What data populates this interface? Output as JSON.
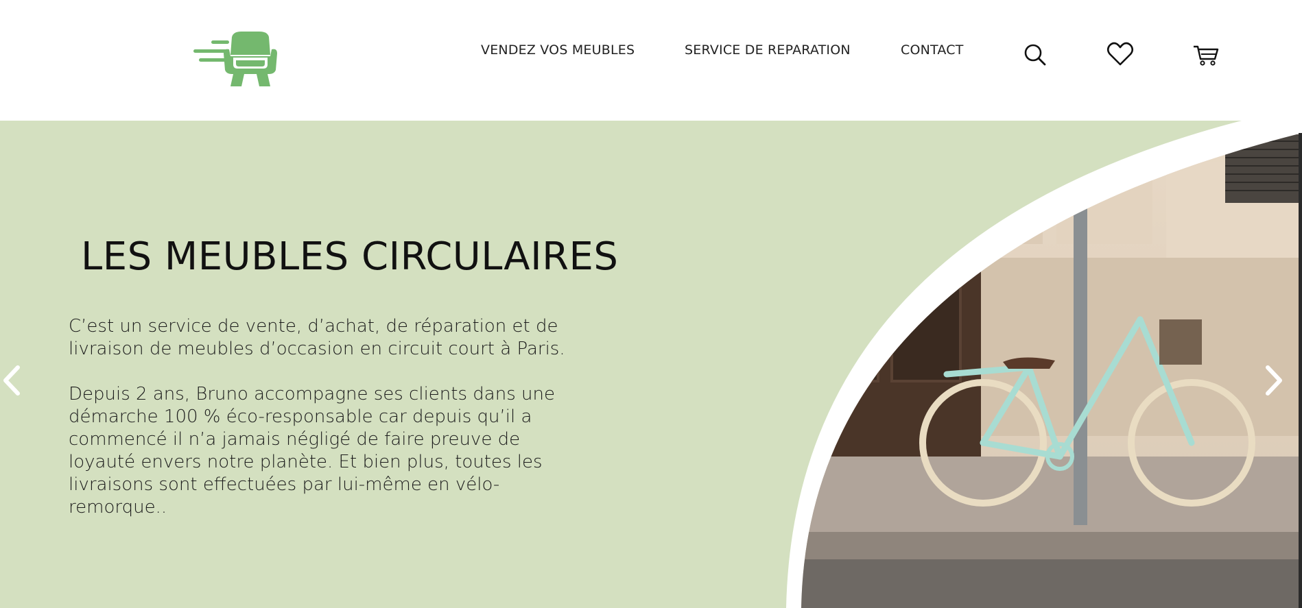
{
  "header": {
    "nav": {
      "sell": "VENDEZ VOS MEUBLES",
      "repair": "SERVICE DE REPARATION",
      "contact": "CONTACT"
    },
    "icons": {
      "logo": "armchair-logo-icon",
      "search": "search-icon",
      "wishlist": "heart-icon",
      "cart": "cart-icon"
    }
  },
  "hero": {
    "title": "LES MEUBLES CIRCULAIRES",
    "paragraph1": "C’est un service de vente, d’achat, de réparation et de livraison de meubles d’occasion en circuit court à Paris.",
    "paragraph2": "Depuis 2 ans, Bruno accompagne ses clients dans une démarche 100 % éco-responsable car depuis qu’il a commencé il n’a jamais négligé de faire preuve de loyauté envers notre planète. Et bien plus, toutes les livraisons sont effectuées par lui-même en vélo-remorque..",
    "icons": {
      "prev": "chevron-left-icon",
      "next": "chevron-right-icon"
    }
  },
  "colors": {
    "brand_green": "#74b86e",
    "hero_background": "#d4e0c0",
    "bike_mint": "#a8dcd2"
  }
}
